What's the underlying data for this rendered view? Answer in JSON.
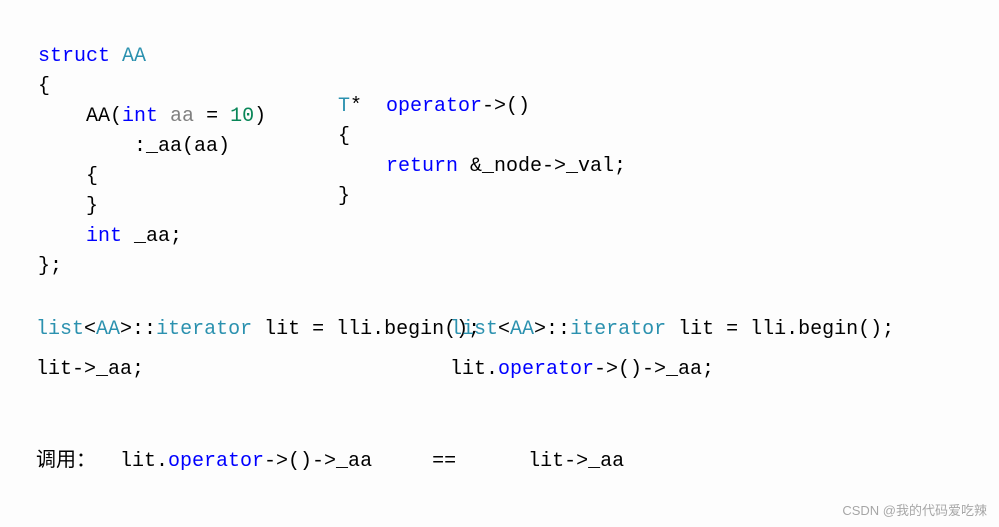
{
  "struct_block": {
    "l1_kw": "struct",
    "l1_name": " AA",
    "l2": "{",
    "l3_name": "    AA",
    "l3_paren_open": "(",
    "l3_int": "int",
    "l3_param": " aa ",
    "l3_eq": "= ",
    "l3_num": "10",
    "l3_paren_close": ")",
    "l4": "        :_aa(aa)",
    "l5": "    {",
    "l6": "    }",
    "l7_int": "    int",
    "l7_var": " _aa;",
    "l8": "};"
  },
  "op_block": {
    "l1_type": "T",
    "l1_star": "*  ",
    "l1_op": "operator",
    "l1_arrow": "->()",
    "l2": "{",
    "l3_ret": "    return",
    "l3_expr": " &_node->_val;",
    "l4": "}"
  },
  "left": {
    "decl_list": "list",
    "decl_lt": "<",
    "decl_aa": "AA",
    "decl_gt": ">::",
    "decl_iter": "iterator",
    "decl_rest": " lit = lli.begin();",
    "use": "lit->_aa;"
  },
  "right": {
    "decl_list": "list",
    "decl_lt": "<",
    "decl_aa": "AA",
    "decl_gt": ">::",
    "decl_iter": "iterator",
    "decl_rest": " lit = lli.begin();",
    "use_pre": "lit.",
    "use_op": "operator",
    "use_post": "->()->_aa;"
  },
  "bottom": {
    "label": "调用：",
    "pad1": "  ",
    "lhs_pre": "lit.",
    "lhs_op": "operator",
    "lhs_post": "->()->_aa",
    "eq": "     ==      ",
    "rhs": "lit->_aa"
  },
  "watermark": "CSDN @我的代码爱吃辣"
}
